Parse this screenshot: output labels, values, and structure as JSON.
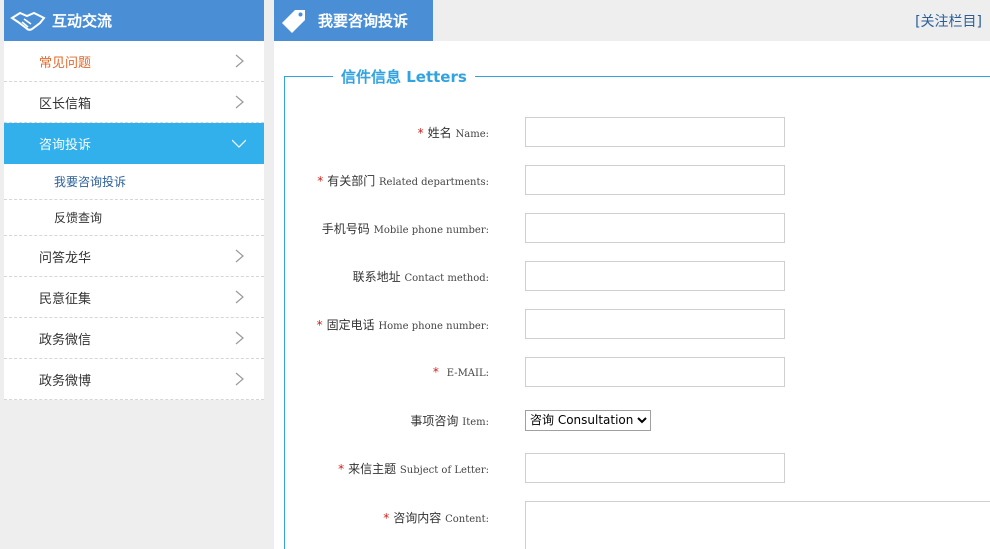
{
  "sidebar": {
    "title": "互动交流",
    "items": [
      {
        "label": "常见问题"
      },
      {
        "label": "区长信箱"
      },
      {
        "label": "咨询投诉"
      },
      {
        "label": "问答龙华"
      },
      {
        "label": "民意征集"
      },
      {
        "label": "政务微信"
      },
      {
        "label": "政务微博"
      }
    ],
    "subitems": [
      {
        "label": "我要咨询投诉"
      },
      {
        "label": "反馈查询"
      }
    ],
    "colors": {
      "header": "#4a8fd6",
      "active": "#31b0ec",
      "highlight": "#e5682a"
    }
  },
  "main": {
    "tab_title": "我要咨询投诉",
    "follow_link": "[关注栏目]",
    "legend": "信件信息 Letters",
    "fields": [
      {
        "cn": "姓名",
        "en": "Name:",
        "required": "*"
      },
      {
        "cn": "有关部门",
        "en": "Related departments:",
        "required": "*"
      },
      {
        "cn": "手机号码",
        "en": "Mobile phone number:",
        "required": ""
      },
      {
        "cn": "联系地址",
        "en": "Contact method:",
        "required": ""
      },
      {
        "cn": "固定电话",
        "en": "Home phone number:",
        "required": "*"
      },
      {
        "cn": "",
        "en": "E-MAIL:",
        "required": "*"
      },
      {
        "cn": "事项咨询",
        "en": "Item:",
        "required": ""
      },
      {
        "cn": "来信主题",
        "en": "Subject of Letter:",
        "required": "*"
      },
      {
        "cn": "咨询内容",
        "en": "Content:",
        "required": "*"
      }
    ],
    "item_select": {
      "selected": "咨询 Consultation"
    }
  }
}
